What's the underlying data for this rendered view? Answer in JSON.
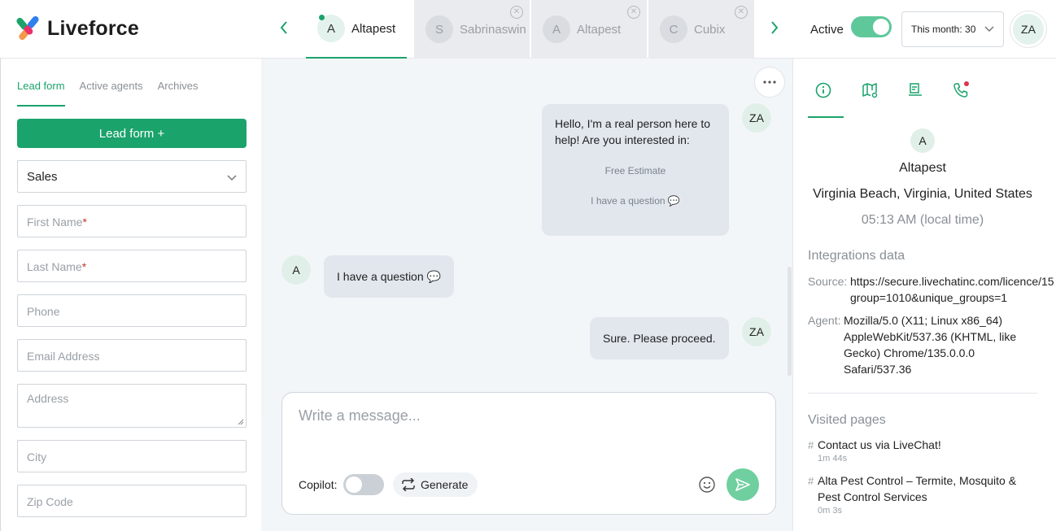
{
  "app": {
    "name": "Liveforce"
  },
  "colors": {
    "accent": "#1aa36b",
    "bubble": "#e2e7ee",
    "notification": "#e0324a"
  },
  "header": {
    "tabs": [
      {
        "initial": "A",
        "name": "Altapest",
        "active": true
      },
      {
        "initial": "S",
        "name": "Sabrinaswin",
        "active": false
      },
      {
        "initial": "A",
        "name": "Altapest",
        "active": false
      },
      {
        "initial": "C",
        "name": "Cubix",
        "active": false
      }
    ],
    "status_label": "Active",
    "status_on": true,
    "month_select": "This month: 30",
    "user_initials": "ZA"
  },
  "sidebar": {
    "tabs": [
      "Lead form",
      "Active agents",
      "Archives"
    ],
    "lead_form_button": "Lead form +",
    "department": "Sales",
    "fields": {
      "first_name": "First Name",
      "last_name": "Last Name",
      "phone": "Phone",
      "email": "Email Address",
      "address": "Address",
      "city": "City",
      "zip": "Zip Code"
    },
    "required_mark": "*"
  },
  "chat": {
    "messages": [
      {
        "from": "agent",
        "initials": "ZA",
        "text": "Hello, I'm a real person here to help! Are you interested in:",
        "options": [
          "Free Estimate",
          "I have a question 💬"
        ]
      },
      {
        "from": "visitor",
        "initials": "A",
        "text": "I have a question 💬"
      },
      {
        "from": "agent",
        "initials": "ZA",
        "text": "Sure. Please proceed."
      }
    ],
    "composer": {
      "placeholder": "Write a message...",
      "copilot_label": "Copilot:",
      "copilot_on": false,
      "generate_label": "Generate"
    }
  },
  "details": {
    "visitor_initial": "A",
    "visitor_name": "Altapest",
    "location": "Virginia Beach, Virginia, United States",
    "local_time": "05:13 AM (local time)",
    "integrations_title": "Integrations data",
    "source_label": "Source:",
    "source_lines": [
      "https://secure.livechatinc.com/licence/15",
      "group=1010&unique_groups=1"
    ],
    "agent_label": "Agent:",
    "agent_lines": [
      "Mozilla/5.0 (X11; Linux x86_64)",
      "AppleWebKit/537.36 (KHTML, like",
      "Gecko) Chrome/135.0.0.0",
      "Safari/537.36"
    ],
    "visited_title": "Visited pages",
    "hash": "#",
    "visited_pages": [
      {
        "title_lines": [
          "Contact us via LiveChat!"
        ],
        "duration": "1m 44s"
      },
      {
        "title_lines": [
          "Alta Pest Control – Termite, Mosquito &",
          "Pest Control Services"
        ],
        "duration": "0m 3s"
      }
    ]
  }
}
